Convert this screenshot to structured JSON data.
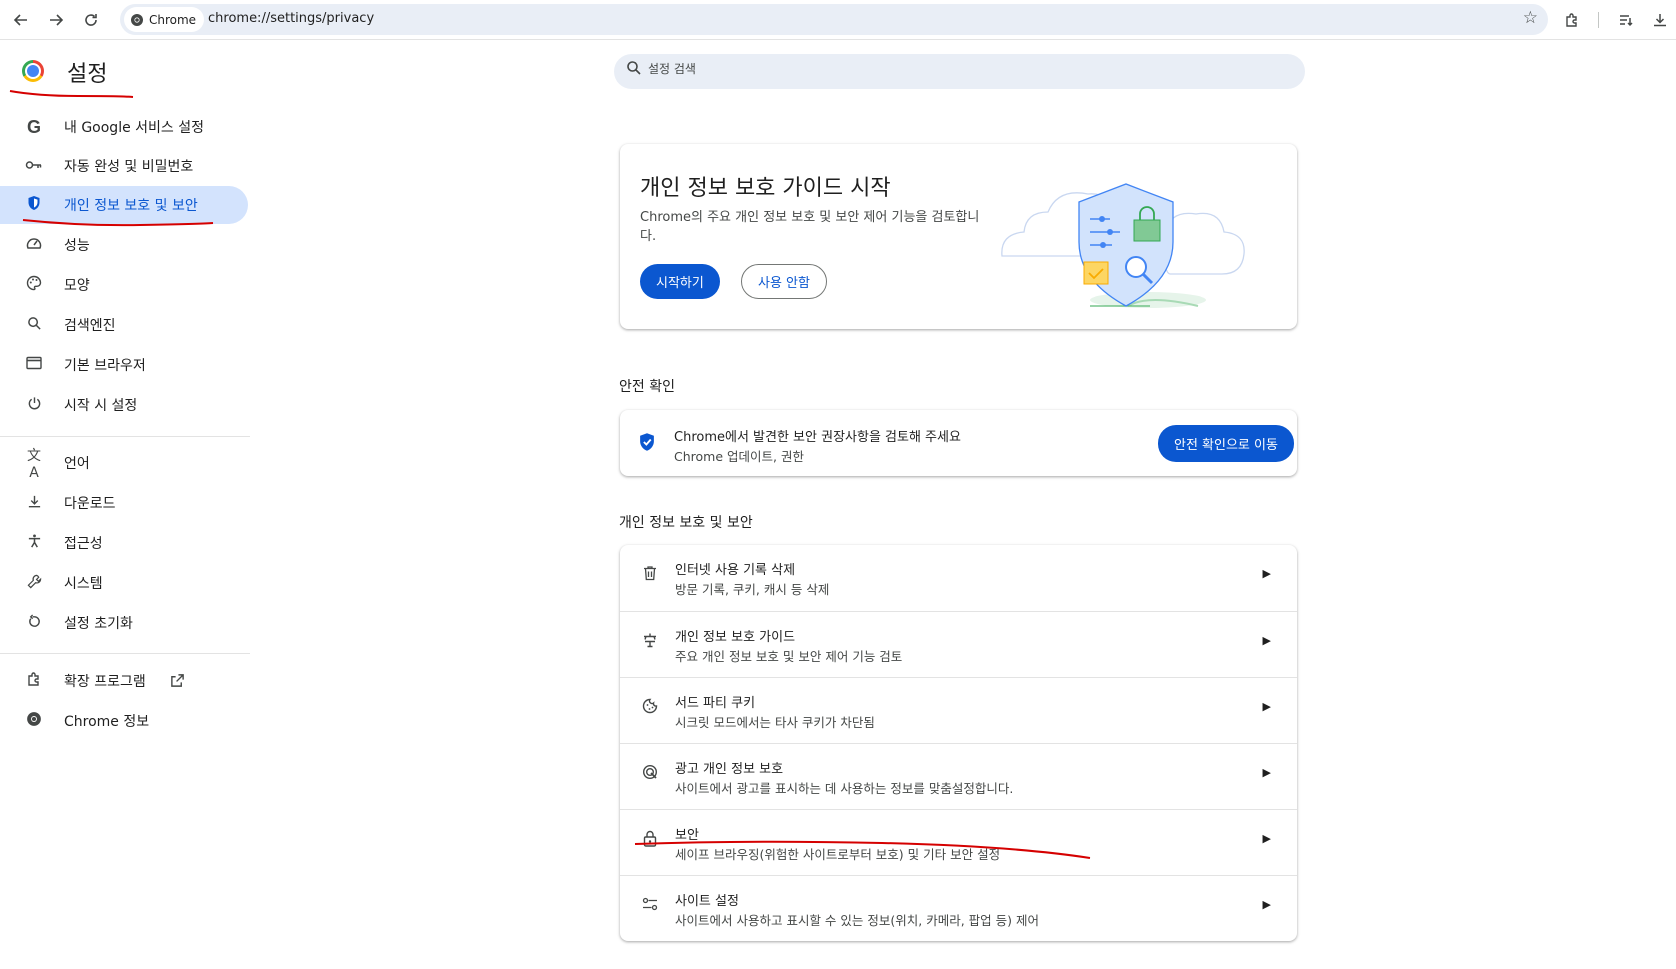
{
  "browser": {
    "chip_label": "Chrome",
    "url": "chrome://settings/privacy"
  },
  "header": {
    "title": "설정",
    "search_placeholder": "설정 검색"
  },
  "sidebar": {
    "items": [
      {
        "label": "내 Google 서비스 설정",
        "icon": "google-icon"
      },
      {
        "label": "자동 완성 및 비밀번호",
        "icon": "key-icon"
      },
      {
        "label": "개인 정보 보호 및 보안",
        "icon": "shield-icon",
        "active": true
      },
      {
        "label": "성능",
        "icon": "speedometer-icon"
      },
      {
        "label": "모양",
        "icon": "palette-icon"
      },
      {
        "label": "검색엔진",
        "icon": "search-icon"
      },
      {
        "label": "기본 브라우저",
        "icon": "browser-window-icon"
      },
      {
        "label": "시작 시 설정",
        "icon": "power-icon"
      },
      {
        "label": "언어",
        "icon": "translate-icon"
      },
      {
        "label": "다운로드",
        "icon": "download-icon"
      },
      {
        "label": "접근성",
        "icon": "accessibility-icon"
      },
      {
        "label": "시스템",
        "icon": "wrench-icon"
      },
      {
        "label": "설정 초기화",
        "icon": "reset-icon"
      },
      {
        "label": "확장 프로그램",
        "icon": "puzzle-icon"
      },
      {
        "label": "Chrome 정보",
        "icon": "chrome-icon"
      }
    ]
  },
  "guide_card": {
    "title": "개인 정보 보호 가이드 시작",
    "description": "Chrome의 주요 개인 정보 보호 및 보안 제어 기능을 검토합니다.",
    "start_button": "시작하기",
    "dismiss_button": "사용 안함"
  },
  "safety_check": {
    "section_title": "안전 확인",
    "title": "Chrome에서 발견한 보안 권장사항을 검토해 주세요",
    "subtitle": "Chrome 업데이트, 권한",
    "button": "안전 확인으로 이동"
  },
  "privacy_section": {
    "section_title": "개인 정보 보호 및 보안",
    "rows": [
      {
        "title": "인터넷 사용 기록 삭제",
        "subtitle": "방문 기록, 쿠키, 캐시 등 삭제",
        "icon": "trash-icon"
      },
      {
        "title": "개인 정보 보호 가이드",
        "subtitle": "주요 개인 정보 보호 및 보안 제어 기능 검토",
        "icon": "privacy-guide-icon"
      },
      {
        "title": "서드 파티 쿠키",
        "subtitle": "시크릿 모드에서는 타사 쿠키가 차단됨",
        "icon": "cookie-icon"
      },
      {
        "title": "광고 개인 정보 보호",
        "subtitle": "사이트에서 광고를 표시하는 데 사용하는 정보를 맞춤설정합니다.",
        "icon": "ad-privacy-icon"
      },
      {
        "title": "보안",
        "subtitle": "세이프 브라우징(위험한 사이트로부터 보호) 및 기타 보안 설정",
        "icon": "lock-icon"
      },
      {
        "title": "사이트 설정",
        "subtitle": "사이트에서 사용하고 표시할 수 있는 정보(위치, 카메라, 팝업 등) 제어",
        "icon": "tune-icon"
      }
    ]
  },
  "colors": {
    "accent": "#0b57d0",
    "active_nav_bg": "#d3e3fd",
    "annotation_red": "#d50000"
  }
}
